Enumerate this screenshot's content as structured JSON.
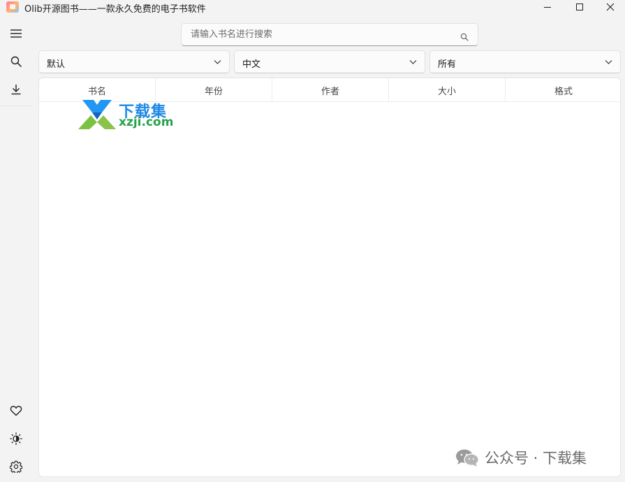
{
  "window": {
    "title": "Olib开源图书——一款永久免费的电子书软件",
    "icon": "app-icon"
  },
  "sidebar": {
    "items": [
      {
        "name": "menu",
        "icon": "hamburger-icon"
      },
      {
        "name": "search",
        "icon": "search-icon"
      },
      {
        "name": "downloads",
        "icon": "download-icon"
      },
      {
        "name": "favorites",
        "icon": "heart-icon"
      },
      {
        "name": "theme",
        "icon": "theme-toggle-icon"
      },
      {
        "name": "settings",
        "icon": "gear-icon"
      }
    ]
  },
  "search": {
    "placeholder": "请输入书名进行搜索",
    "value": "",
    "icon": "search-icon"
  },
  "filters": {
    "sort": "默认",
    "language": "中文",
    "format": "所有"
  },
  "table": {
    "columns": [
      "书名",
      "年份",
      "作者",
      "大小",
      "格式"
    ],
    "rows": []
  },
  "watermarks": {
    "logo_name": "下载集",
    "logo_url": "xzji.com",
    "wechat_label": "公众号 · 下载集"
  },
  "colors": {
    "background": "#f3f3f3",
    "panel": "#ffffff",
    "logo_blue": "#1e88e5",
    "logo_green": "#7cc242"
  }
}
